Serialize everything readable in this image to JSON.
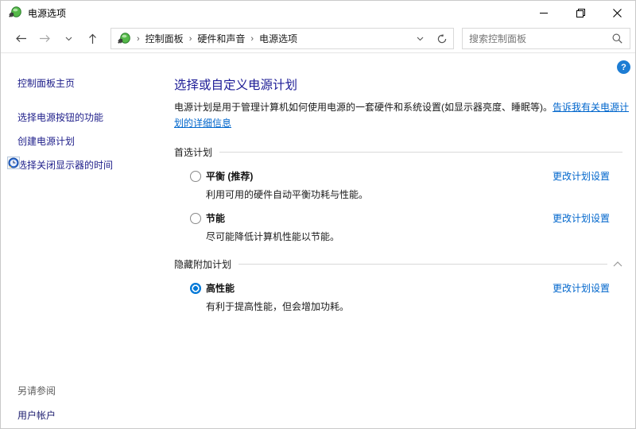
{
  "window": {
    "title": "电源选项"
  },
  "navbar": {
    "breadcrumb": [
      "控制面板",
      "硬件和声音",
      "电源选项"
    ],
    "search_placeholder": "搜索控制面板"
  },
  "sidebar": {
    "home_label": "控制面板主页",
    "tasks": [
      {
        "label": "选择电源按钮的功能"
      },
      {
        "label": "创建电源计划"
      },
      {
        "label": "选择关闭显示器的时间"
      }
    ],
    "see_also_header": "另请参阅",
    "see_also_links": [
      {
        "label": "用户帐户"
      }
    ]
  },
  "main": {
    "title": "选择或自定义电源计划",
    "intro_text": "电源计划是用于管理计算机如何使用电源的一套硬件和系统设置(如显示器亮度、睡眠等)。",
    "intro_link": "告诉我有关电源计划的详细信息",
    "section_preferred": "首选计划",
    "section_hidden": "隐藏附加计划",
    "plans": [
      {
        "name": "平衡 (推荐)",
        "desc": "利用可用的硬件自动平衡功耗与性能。",
        "link": "更改计划设置",
        "selected": false
      },
      {
        "name": "节能",
        "desc": "尽可能降低计算机性能以节能。",
        "link": "更改计划设置",
        "selected": false
      },
      {
        "name": "高性能",
        "desc": "有利于提高性能，但会增加功耗。",
        "link": "更改计划设置",
        "selected": true
      }
    ],
    "help_glyph": "?"
  },
  "colors": {
    "heading_navy": "#1d1c96",
    "sidebar_navy": "#20208b",
    "link_blue": "#0066cc",
    "radio_blue": "#0078d7",
    "help_blue": "#1d7dd4"
  }
}
